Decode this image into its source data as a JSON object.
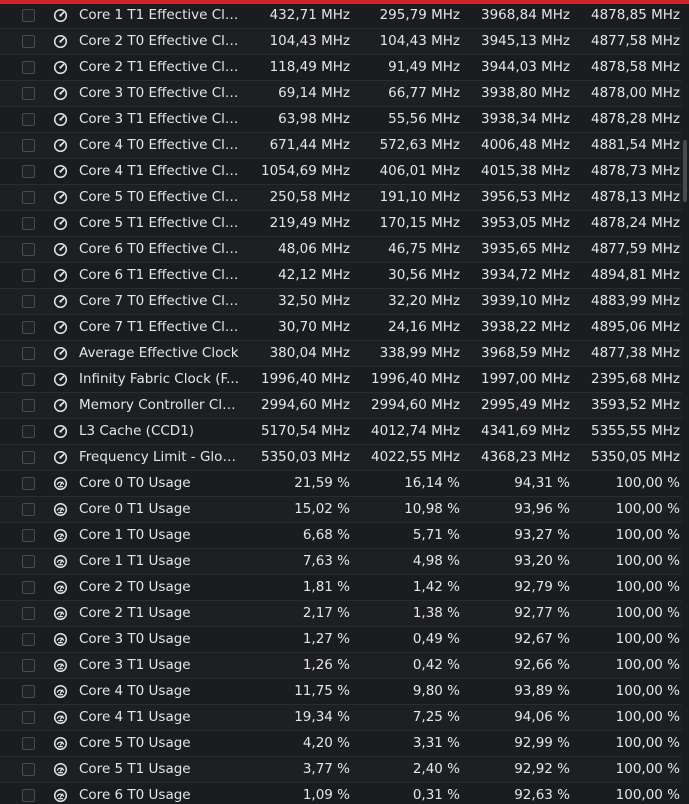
{
  "colors": {
    "accent": "#d4202a",
    "background": "#1b1c20",
    "text": "#e4e5e8"
  },
  "icons": {
    "clock": "speedometer-icon",
    "usage": "usage-gauge-icon"
  },
  "rows": [
    {
      "icon": "clock",
      "label": "Core 1 T1 Effective Clo...",
      "values": [
        "432,71 MHz",
        "295,79 MHz",
        "3968,84 MHz",
        "4878,85 MHz"
      ]
    },
    {
      "icon": "clock",
      "label": "Core 2 T0 Effective Clo...",
      "values": [
        "104,43 MHz",
        "104,43 MHz",
        "3945,13 MHz",
        "4877,58 MHz"
      ]
    },
    {
      "icon": "clock",
      "label": "Core 2 T1 Effective Clo...",
      "values": [
        "118,49 MHz",
        "91,49 MHz",
        "3944,03 MHz",
        "4878,58 MHz"
      ]
    },
    {
      "icon": "clock",
      "label": "Core 3 T0 Effective Clo...",
      "values": [
        "69,14 MHz",
        "66,77 MHz",
        "3938,80 MHz",
        "4878,00 MHz"
      ]
    },
    {
      "icon": "clock",
      "label": "Core 3 T1 Effective Clo...",
      "values": [
        "63,98 MHz",
        "55,56 MHz",
        "3938,34 MHz",
        "4878,28 MHz"
      ]
    },
    {
      "icon": "clock",
      "label": "Core 4 T0 Effective Clo...",
      "values": [
        "671,44 MHz",
        "572,63 MHz",
        "4006,48 MHz",
        "4881,54 MHz"
      ]
    },
    {
      "icon": "clock",
      "label": "Core 4 T1 Effective Clo...",
      "values": [
        "1054,69 MHz",
        "406,01 MHz",
        "4015,38 MHz",
        "4878,73 MHz"
      ]
    },
    {
      "icon": "clock",
      "label": "Core 5 T0 Effective Clo...",
      "values": [
        "250,58 MHz",
        "191,10 MHz",
        "3956,53 MHz",
        "4878,13 MHz"
      ]
    },
    {
      "icon": "clock",
      "label": "Core 5 T1 Effective Clo...",
      "values": [
        "219,49 MHz",
        "170,15 MHz",
        "3953,05 MHz",
        "4878,24 MHz"
      ]
    },
    {
      "icon": "clock",
      "label": "Core 6 T0 Effective Clo...",
      "values": [
        "48,06 MHz",
        "46,75 MHz",
        "3935,65 MHz",
        "4877,59 MHz"
      ]
    },
    {
      "icon": "clock",
      "label": "Core 6 T1 Effective Clo...",
      "values": [
        "42,12 MHz",
        "30,56 MHz",
        "3934,72 MHz",
        "4894,81 MHz"
      ]
    },
    {
      "icon": "clock",
      "label": "Core 7 T0 Effective Clo...",
      "values": [
        "32,50 MHz",
        "32,20 MHz",
        "3939,10 MHz",
        "4883,99 MHz"
      ]
    },
    {
      "icon": "clock",
      "label": "Core 7 T1 Effective Clo...",
      "values": [
        "30,70 MHz",
        "24,16 MHz",
        "3938,22 MHz",
        "4895,06 MHz"
      ]
    },
    {
      "icon": "clock",
      "label": "Average Effective Clock",
      "values": [
        "380,04 MHz",
        "338,99 MHz",
        "3968,59 MHz",
        "4877,38 MHz"
      ]
    },
    {
      "icon": "clock",
      "label": "Infinity Fabric Clock (F...",
      "values": [
        "1996,40 MHz",
        "1996,40 MHz",
        "1997,00 MHz",
        "2395,68 MHz"
      ]
    },
    {
      "icon": "clock",
      "label": "Memory Controller Clo...",
      "values": [
        "2994,60 MHz",
        "2994,60 MHz",
        "2995,49 MHz",
        "3593,52 MHz"
      ]
    },
    {
      "icon": "clock",
      "label": "L3 Cache (CCD1)",
      "values": [
        "5170,54 MHz",
        "4012,74 MHz",
        "4341,69 MHz",
        "5355,55 MHz"
      ]
    },
    {
      "icon": "clock",
      "label": "Frequency Limit - Global",
      "values": [
        "5350,03 MHz",
        "4022,55 MHz",
        "4368,23 MHz",
        "5350,05 MHz"
      ]
    },
    {
      "icon": "usage",
      "label": "Core 0 T0 Usage",
      "values": [
        "21,59 %",
        "16,14 %",
        "94,31 %",
        "100,00 %"
      ]
    },
    {
      "icon": "usage",
      "label": "Core 0 T1 Usage",
      "values": [
        "15,02 %",
        "10,98 %",
        "93,96 %",
        "100,00 %"
      ]
    },
    {
      "icon": "usage",
      "label": "Core 1 T0 Usage",
      "values": [
        "6,68 %",
        "5,71 %",
        "93,27 %",
        "100,00 %"
      ]
    },
    {
      "icon": "usage",
      "label": "Core 1 T1 Usage",
      "values": [
        "7,63 %",
        "4,98 %",
        "93,20 %",
        "100,00 %"
      ]
    },
    {
      "icon": "usage",
      "label": "Core 2 T0 Usage",
      "values": [
        "1,81 %",
        "1,42 %",
        "92,79 %",
        "100,00 %"
      ]
    },
    {
      "icon": "usage",
      "label": "Core 2 T1 Usage",
      "values": [
        "2,17 %",
        "1,38 %",
        "92,77 %",
        "100,00 %"
      ]
    },
    {
      "icon": "usage",
      "label": "Core 3 T0 Usage",
      "values": [
        "1,27 %",
        "0,49 %",
        "92,67 %",
        "100,00 %"
      ]
    },
    {
      "icon": "usage",
      "label": "Core 3 T1 Usage",
      "values": [
        "1,26 %",
        "0,42 %",
        "92,66 %",
        "100,00 %"
      ]
    },
    {
      "icon": "usage",
      "label": "Core 4 T0 Usage",
      "values": [
        "11,75 %",
        "9,80 %",
        "93,89 %",
        "100,00 %"
      ]
    },
    {
      "icon": "usage",
      "label": "Core 4 T1 Usage",
      "values": [
        "19,34 %",
        "7,25 %",
        "94,06 %",
        "100,00 %"
      ]
    },
    {
      "icon": "usage",
      "label": "Core 5 T0 Usage",
      "values": [
        "4,20 %",
        "3,31 %",
        "92,99 %",
        "100,00 %"
      ]
    },
    {
      "icon": "usage",
      "label": "Core 5 T1 Usage",
      "values": [
        "3,77 %",
        "2,40 %",
        "92,92 %",
        "100,00 %"
      ]
    },
    {
      "icon": "usage",
      "label": "Core 6 T0 Usage",
      "values": [
        "1,09 %",
        "0,31 %",
        "92,63 %",
        "100,00 %"
      ]
    }
  ]
}
